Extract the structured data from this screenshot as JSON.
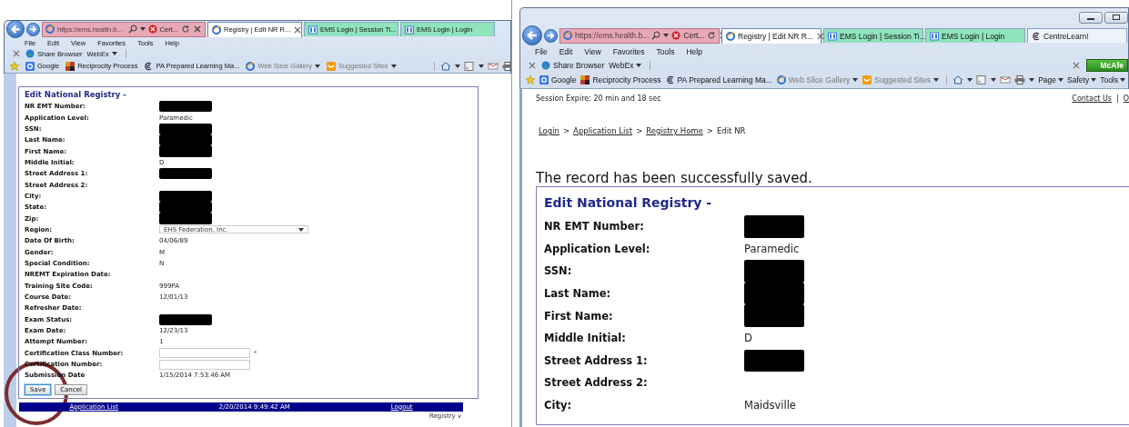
{
  "windows": [
    {
      "address": {
        "url": "https://ems.health.b...",
        "cert": "Cert..."
      },
      "tabs": [
        {
          "label": "Registry | Edit NR R...",
          "selected": true,
          "kind": "browser",
          "color": "#ffffff"
        },
        {
          "label": "EMS Login | Session Ti...",
          "selected": false,
          "kind": "app",
          "color": "#8fe3bd"
        },
        {
          "label": "EMS Login | Login",
          "selected": false,
          "kind": "app",
          "color": "#8fe3bd"
        }
      ],
      "menu": [
        "File",
        "Edit",
        "View",
        "Favorites",
        "Tools",
        "Help"
      ],
      "toolbar": {
        "share": "Share Browser",
        "webex": "WebEx"
      },
      "favorites": [
        {
          "label": "Google",
          "kind": "google",
          "muted": false,
          "dropdown": false
        },
        {
          "label": "Reciprocity Process",
          "kind": "flag",
          "muted": false,
          "dropdown": false
        },
        {
          "label": "PA Prepared Learning Ma...",
          "kind": "swirl",
          "muted": false,
          "dropdown": false
        },
        {
          "label": "Web Slice Gallery",
          "kind": "browser",
          "muted": true,
          "dropdown": true
        },
        {
          "label": "Suggested Sites",
          "kind": "slice",
          "muted": true,
          "dropdown": true
        }
      ],
      "form": {
        "title": "Edit National Registry -",
        "rows": [
          {
            "label": "NR EMT Number:",
            "kind": "redacted"
          },
          {
            "label": "Application Level:",
            "kind": "text",
            "value": "Paramedic"
          },
          {
            "label": "SSN:",
            "kind": "redacted"
          },
          {
            "label": "Last Name:",
            "kind": "redacted"
          },
          {
            "label": "First Name:",
            "kind": "redacted"
          },
          {
            "label": "Middle Initial:",
            "kind": "text",
            "value": "D"
          },
          {
            "label": "Street Address 1:",
            "kind": "redacted"
          },
          {
            "label": "Street Address 2:",
            "kind": "empty"
          },
          {
            "label": "City:",
            "kind": "redacted"
          },
          {
            "label": "State:",
            "kind": "redacted"
          },
          {
            "label": "Zip:",
            "kind": "redacted"
          },
          {
            "label": "Region:",
            "kind": "select",
            "value": "EHS Federation, Inc."
          },
          {
            "label": "Date Of Birth:",
            "kind": "text",
            "value": "04/06/89"
          },
          {
            "label": "Gender:",
            "kind": "text",
            "value": "M"
          },
          {
            "label": "Special Condition:",
            "kind": "text",
            "value": "N"
          },
          {
            "label": "NREMT Expiration Date:",
            "kind": "empty"
          },
          {
            "label": "Training Site Code:",
            "kind": "text",
            "value": "999PA"
          },
          {
            "label": "Course Date:",
            "kind": "text",
            "value": "12/01/13"
          },
          {
            "label": "Refresher Date:",
            "kind": "empty"
          },
          {
            "label": "Exam Status:",
            "kind": "redacted"
          },
          {
            "label": "Exam Date:",
            "kind": "text",
            "value": "12/23/13"
          },
          {
            "label": "Attempt Number:",
            "kind": "text",
            "value": "1"
          },
          {
            "label": "Certification Class Number:",
            "kind": "input",
            "required_mark": "*"
          },
          {
            "label": "Certification Number:",
            "kind": "input"
          },
          {
            "label": "Submission Date",
            "kind": "text",
            "value": "1/15/2014 7:53:46 AM"
          }
        ],
        "buttons": [
          {
            "label": "Save",
            "focused": true
          },
          {
            "label": "Cancel",
            "focused": false
          }
        ]
      },
      "footer": {
        "left": "Application List",
        "center": "2/20/2014 9:49:42 AM",
        "right": "Logout"
      },
      "below_footer": "Registry v"
    },
    {
      "address": {
        "url": "https://ems.health.b...",
        "cert": "Cert..."
      },
      "tabs": [
        {
          "label": "Registry | Edit NR R...",
          "selected": true,
          "kind": "browser",
          "color": "#ffffff"
        },
        {
          "label": "EMS Login | Session Ti...",
          "selected": false,
          "kind": "app",
          "color": "#8fe3bd"
        },
        {
          "label": "EMS Login | Login",
          "selected": false,
          "kind": "app",
          "color": "#8fe3bd"
        },
        {
          "label": "CentreLearn!",
          "selected": false,
          "kind": "swirl",
          "color": "#eef3fa"
        }
      ],
      "menu": [
        "File",
        "Edit",
        "View",
        "Favorites",
        "Tools",
        "Help"
      ],
      "toolbar": {
        "share": "Share Browser",
        "webex": "WebEx",
        "addon": "McAfe"
      },
      "favorites": [
        {
          "label": "Google",
          "kind": "google",
          "muted": false,
          "dropdown": false
        },
        {
          "label": "Reciprocity Process",
          "kind": "flag",
          "muted": false,
          "dropdown": false
        },
        {
          "label": "PA Prepared Learning Ma...",
          "kind": "swirl",
          "muted": false,
          "dropdown": false
        },
        {
          "label": "Web Slice Gallery",
          "kind": "browser",
          "muted": true,
          "dropdown": true
        },
        {
          "label": "Suggested Sites",
          "kind": "slice",
          "muted": true,
          "dropdown": true
        }
      ],
      "commands": [
        "Page",
        "Safety",
        "Tools"
      ],
      "session": "Session Expire: 20 min and 18 sec",
      "top_links": [
        {
          "label": "Contact Us",
          "kind": "link"
        },
        {
          "label": "|",
          "kind": "separator"
        },
        {
          "label": "O",
          "kind": "link"
        }
      ],
      "breadcrumb": [
        {
          "label": "Login",
          "kind": "link"
        },
        {
          "label": ">",
          "kind": "separator"
        },
        {
          "label": "Application List",
          "kind": "link"
        },
        {
          "label": ">",
          "kind": "separator"
        },
        {
          "label": "Registry Home",
          "kind": "link"
        },
        {
          "label": ">",
          "kind": "separator"
        },
        {
          "label": "Edit NR",
          "kind": "current"
        }
      ],
      "message": "The record has been successfully saved.",
      "form": {
        "title": "Edit National Registry -",
        "rows": [
          {
            "label": "NR EMT Number:",
            "kind": "redacted"
          },
          {
            "label": "Application Level:",
            "kind": "text",
            "value": "Paramedic"
          },
          {
            "label": "SSN:",
            "kind": "redacted"
          },
          {
            "label": "Last Name:",
            "kind": "redacted"
          },
          {
            "label": "First Name:",
            "kind": "redacted"
          },
          {
            "label": "Middle Initial:",
            "kind": "text",
            "value": "D"
          },
          {
            "label": "Street Address 1:",
            "kind": "redacted"
          },
          {
            "label": "Street Address 2:",
            "kind": "empty"
          },
          {
            "label": "City:",
            "kind": "text",
            "value": "Maidsville"
          }
        ]
      }
    }
  ]
}
